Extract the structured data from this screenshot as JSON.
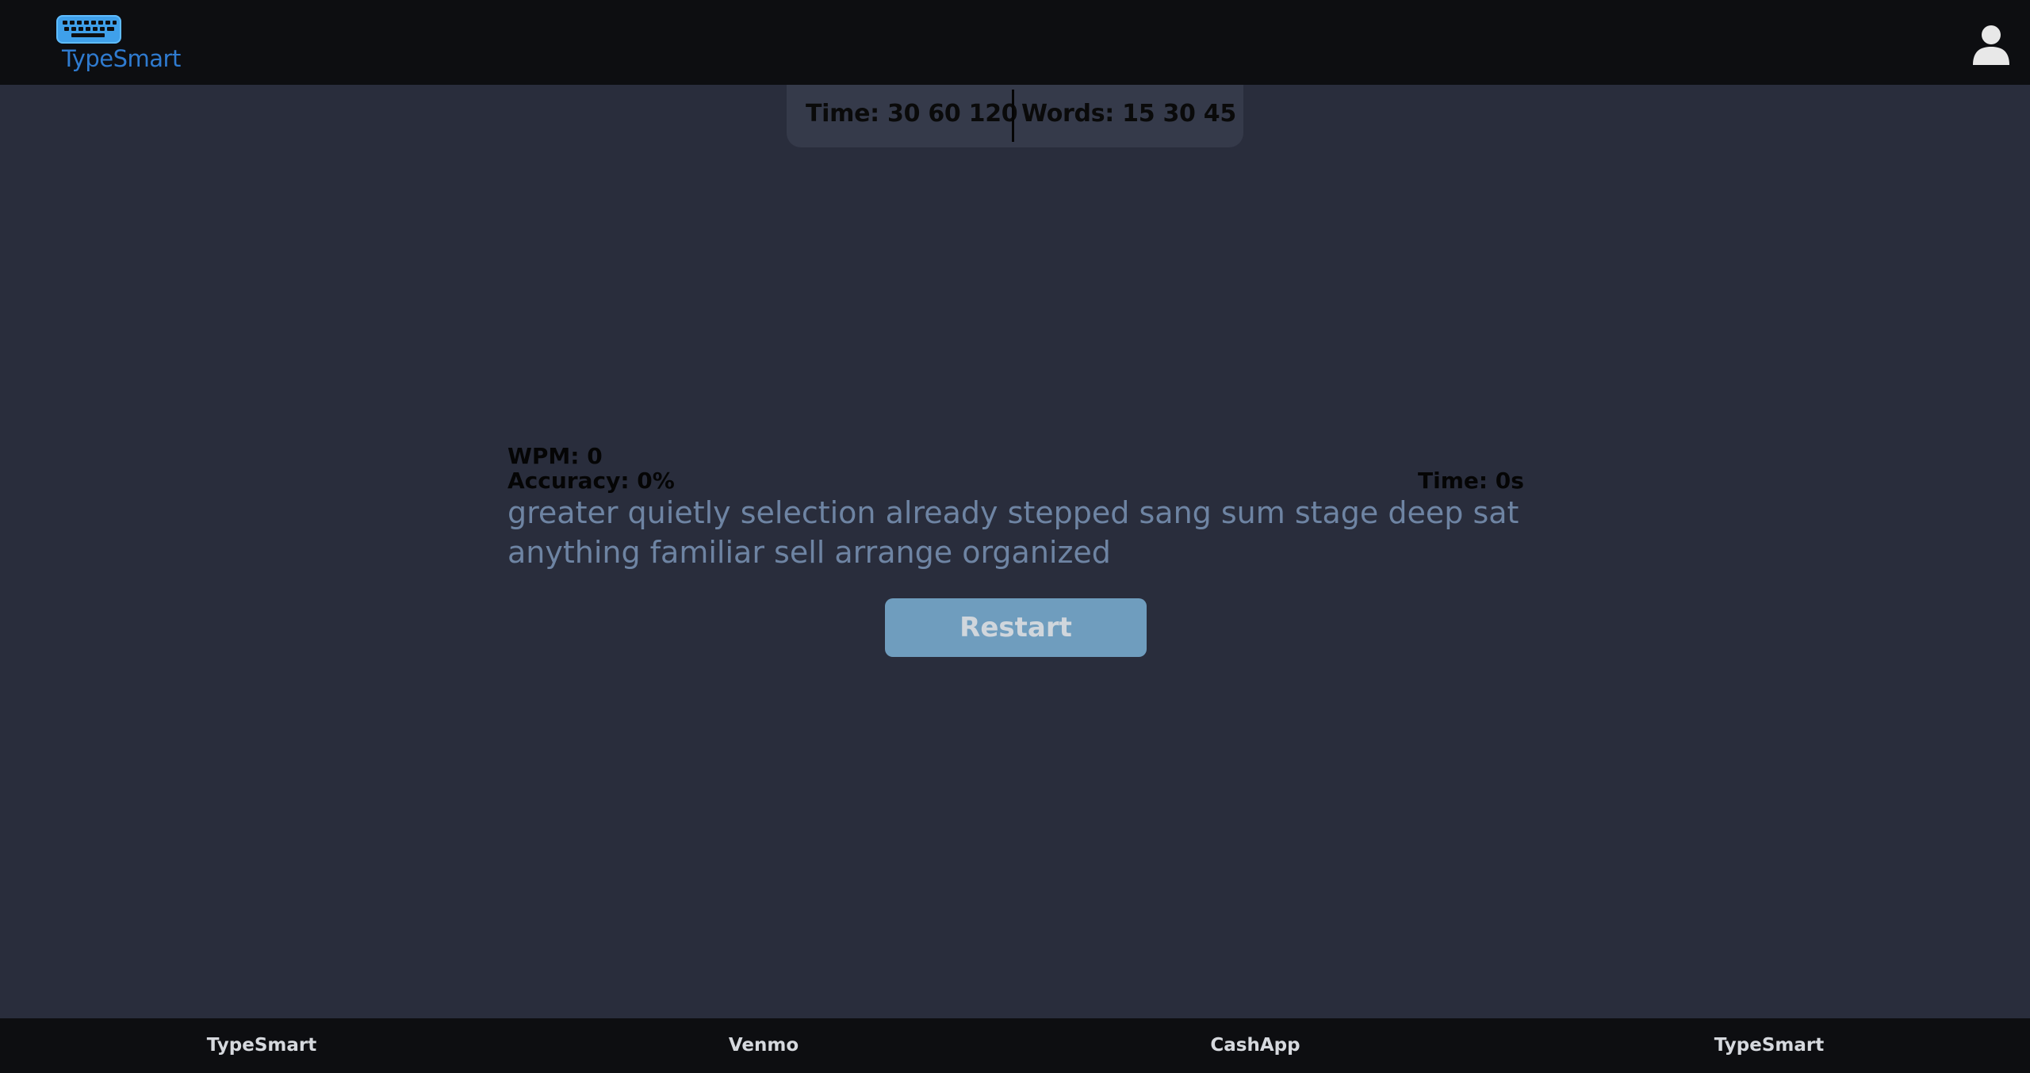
{
  "header": {
    "logo_text": "TypeSmart",
    "logo_icon": "keyboard-icon",
    "user_icon": "user-icon"
  },
  "modes": {
    "time_label": "Time:",
    "time_options": [
      "30",
      "60",
      "120"
    ],
    "words_label": "Words:",
    "words_options": [
      "15",
      "30",
      "45"
    ]
  },
  "stats": {
    "wpm": "WPM: 0",
    "accuracy": "Accuracy: 0%",
    "time": "Time: 0s"
  },
  "words_text": "greater quietly selection already stepped sang sum stage deep sat anything familiar sell arrange organized",
  "restart_label": "Restart",
  "footer": {
    "links": [
      "TypeSmart",
      "Venmo",
      "CashApp",
      "TypeSmart"
    ]
  },
  "colors": {
    "background": "#292d3c",
    "bar": "#0d0e11",
    "accent": "#2f7bd0",
    "button": "#6f9dbe",
    "words": "#6e84a3"
  }
}
